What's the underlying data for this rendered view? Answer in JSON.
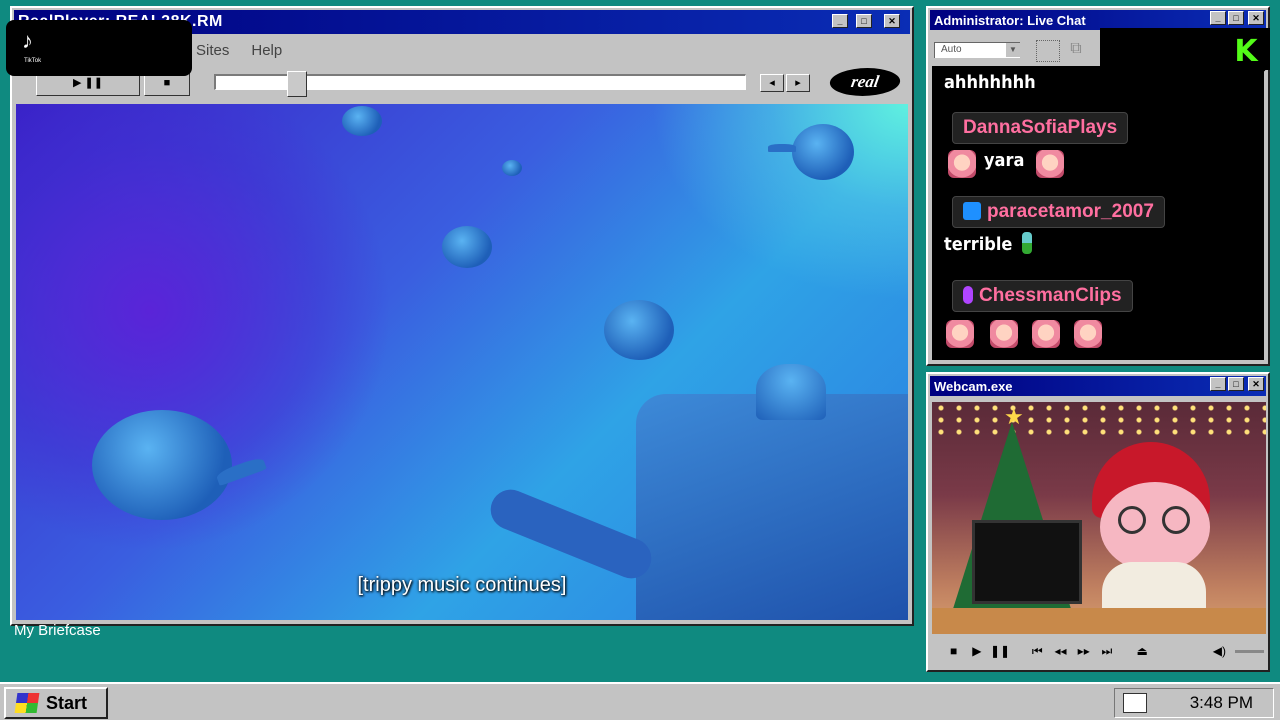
{
  "realplayer": {
    "title": "RealPlayer: REAL28K.RM",
    "menu_sites": "Sites",
    "menu_help": "Help",
    "logo": "real",
    "progress": 0.14,
    "subtitle": "[trippy music continues]"
  },
  "chat": {
    "title": "Administrator: Live Chat",
    "dropdown_value": "Auto",
    "badge": "K",
    "messages": [
      {
        "text": "ahhhhhhh"
      },
      {
        "user": "DannaSofiaPlays",
        "text": "yara"
      },
      {
        "user": "paracetamor_2007",
        "text": "terrible"
      },
      {
        "user": "ChessmanClips"
      }
    ]
  },
  "webcam": {
    "title": "Webcam.exe"
  },
  "desktop": {
    "briefcase_label": "My Briefcase"
  },
  "taskbar": {
    "start_label": "Start",
    "clock": "3:48 PM"
  },
  "overlay": {
    "tiktok_label": "TikTok"
  },
  "colors": {
    "desktop": "#0f8a80",
    "titlebar": "#000080",
    "chat_username": "#ff6fa0",
    "kick_green": "#53fc18"
  }
}
